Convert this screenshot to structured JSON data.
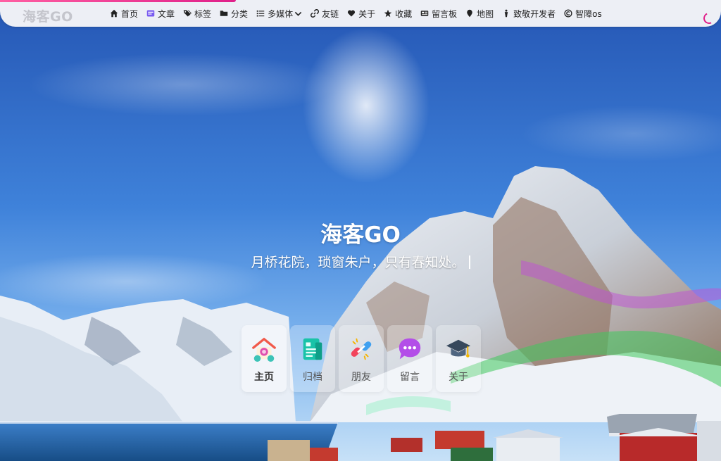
{
  "site": {
    "brand": "海客GO"
  },
  "nav": {
    "items": [
      {
        "label": "首页",
        "icon": "home-icon"
      },
      {
        "label": "文章",
        "icon": "article-icon"
      },
      {
        "label": "标签",
        "icon": "tags-icon"
      },
      {
        "label": "分类",
        "icon": "folder-icon"
      },
      {
        "label": "多媒体",
        "icon": "list-icon"
      },
      {
        "label": "友链",
        "icon": "link-icon"
      },
      {
        "label": "关于",
        "icon": "heart-icon"
      },
      {
        "label": "收藏",
        "icon": "star-icon"
      },
      {
        "label": "留言板",
        "icon": "newspaper-icon"
      },
      {
        "label": "地图",
        "icon": "map-pin-icon"
      },
      {
        "label": "致敬开发者",
        "icon": "person-icon"
      },
      {
        "label": "智障os",
        "icon": "copyright-icon"
      }
    ]
  },
  "hero": {
    "title": "海客GO",
    "subtitle": "月桥花院，琐窗朱户，只有春知处。"
  },
  "cards": [
    {
      "label": "主页",
      "icon": "home-medal-icon"
    },
    {
      "label": "归档",
      "icon": "archive-icon"
    },
    {
      "label": "朋友",
      "icon": "chain-link-icon"
    },
    {
      "label": "留言",
      "icon": "chat-bubble-icon"
    },
    {
      "label": "关于",
      "icon": "graduation-cap-icon"
    }
  ],
  "colors": {
    "accent": "#e0208a",
    "nav_bg": "#f6f6f8",
    "sky_top": "#2a63bf",
    "sky_mid": "#4d8fe0"
  }
}
